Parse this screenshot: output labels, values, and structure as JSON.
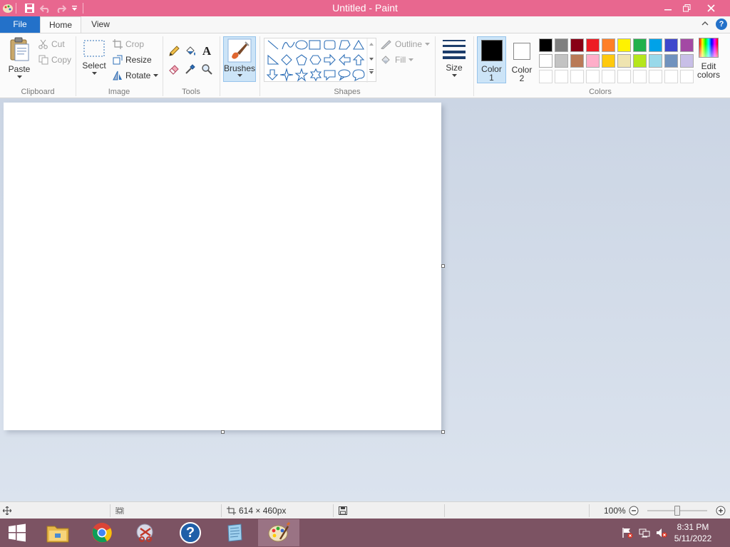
{
  "window": {
    "title": "Untitled - Paint",
    "minimize": "—",
    "restore": "❐",
    "close": "✕"
  },
  "tabs": {
    "file": "File",
    "home": "Home",
    "view": "View"
  },
  "clipboard": {
    "label": "Clipboard",
    "paste": "Paste",
    "cut": "Cut",
    "copy": "Copy"
  },
  "image": {
    "label": "Image",
    "select": "Select",
    "crop": "Crop",
    "resize": "Resize",
    "rotate": "Rotate"
  },
  "tools": {
    "label": "Tools"
  },
  "brushes": {
    "label": "Brushes"
  },
  "shapes": {
    "label": "Shapes",
    "outline": "Outline",
    "fill": "Fill"
  },
  "size": {
    "label": "Size"
  },
  "colors": {
    "label": "Colors",
    "color1_line1": "Color",
    "color1_line2": "1",
    "color2_line1": "Color",
    "color2_line2": "2",
    "edit_line1": "Edit",
    "edit_line2": "colors",
    "color1": "#000000",
    "color2": "#ffffff",
    "palette_row1": [
      "#000000",
      "#7f7f7f",
      "#880015",
      "#ed1c24",
      "#ff7f27",
      "#fff200",
      "#22b14c",
      "#00a2e8",
      "#3f48cc",
      "#a349a4"
    ],
    "palette_row2": [
      "#ffffff",
      "#c3c3c3",
      "#b97a57",
      "#ffaec9",
      "#ffc90e",
      "#efe4b0",
      "#b5e61d",
      "#99d9ea",
      "#7092be",
      "#c8bfe7"
    ]
  },
  "status": {
    "canvas_size": "614 × 460px",
    "zoom": "100%",
    "zoom_level_percent": 100
  },
  "taskbar": {
    "time": "8:31 PM",
    "date": "5/11/2022"
  }
}
